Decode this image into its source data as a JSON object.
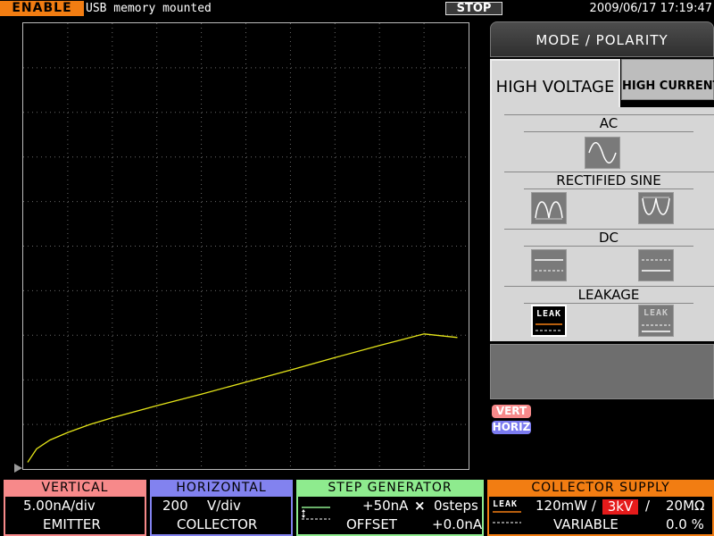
{
  "status_bar": {
    "enable_label": "ENABLE",
    "message": "USB memory mounted",
    "stop_label": "STOP",
    "datetime": "2009/06/17 17:19:47"
  },
  "colors": {
    "trace": "#e6e619",
    "vertical": "#f7898a",
    "horizontal": "#8282ef",
    "step_generator": "#8eeb8e",
    "collector_supply": "#f27d12",
    "enable": "#f27d12",
    "kv_highlight": "#e51b1b"
  },
  "mode_panel": {
    "header": "MODE  /  POLARITY",
    "tabs": [
      {
        "label": "HIGH VOLTAGE",
        "selected": true
      },
      {
        "label": "HIGH CURRENT",
        "selected": false
      }
    ],
    "sections": [
      {
        "title": "AC",
        "icons": [
          "ac-sine-icon"
        ]
      },
      {
        "title": "RECTIFIED  SINE",
        "icons": [
          "rectified-sine-positive-icon",
          "rectified-sine-negative-icon"
        ]
      },
      {
        "title": "DC",
        "icons": [
          "dc-positive-icon",
          "dc-negative-icon"
        ]
      },
      {
        "title": "LEAKAGE",
        "icons": [
          "leakage-positive-icon",
          "leakage-negative-icon"
        ],
        "leak_text": "LEAK",
        "selected_index": 0
      }
    ]
  },
  "legend": {
    "vert": "VERT",
    "horiz": "HORIZ"
  },
  "vertical": {
    "title": "VERTICAL",
    "scale": "5.00nA/div",
    "source": "EMITTER"
  },
  "horizontal": {
    "title": "HORIZONTAL",
    "scale_value": "200",
    "scale_unit": "V/div",
    "source": "COLLECTOR"
  },
  "step_generator": {
    "title": "STEP GENERATOR",
    "step": "+50nA",
    "multiplier": "×",
    "steps": "0steps",
    "offset_label": "OFFSET",
    "offset_value": "+0.0nA"
  },
  "collector_supply": {
    "title": "COLLECTOR SUPPLY",
    "leak_label": "LEAK",
    "power": "120mW /",
    "voltage": "3kV",
    "sep": "/",
    "resistance": "20MΩ",
    "mode": "VARIABLE",
    "percent": "0.0  %"
  },
  "chart_data": {
    "type": "line",
    "title": "",
    "xlabel": "",
    "ylabel": "",
    "grid": true,
    "grid_divisions": [
      10,
      10
    ],
    "x_unit": "div",
    "y_unit": "div",
    "xlim": [
      0,
      10
    ],
    "ylim": [
      0,
      10
    ],
    "series": [
      {
        "x": [
          0.1,
          0.3,
          0.6,
          1.0,
          1.5,
          2.0,
          3.0,
          4.0,
          5.0,
          6.0,
          7.0,
          8.0,
          9.0,
          9.75
        ],
        "y": [
          0.15,
          0.45,
          0.65,
          0.82,
          1.0,
          1.15,
          1.42,
          1.68,
          1.95,
          2.22,
          2.5,
          2.77,
          3.03,
          2.95
        ]
      }
    ]
  }
}
